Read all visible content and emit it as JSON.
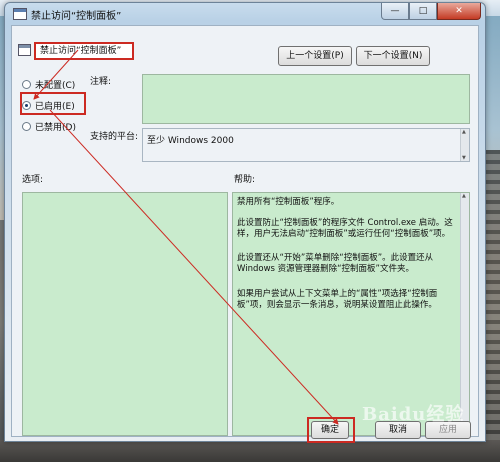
{
  "window": {
    "title": "禁止访问“控制面板”",
    "close_icon": "close-icon",
    "colors": {
      "highlight": "#cc2a22",
      "pane_green": "#c9ebcd"
    }
  },
  "policy": {
    "name": "禁止访问“控制面板”"
  },
  "navigation": {
    "prev_label": "上一个设置(P)",
    "next_label": "下一个设置(N)"
  },
  "state": {
    "options": [
      {
        "label": "未配置(C)",
        "selected": false
      },
      {
        "label": "已启用(E)",
        "selected": true
      },
      {
        "label": "已禁用(D)",
        "selected": false
      }
    ]
  },
  "comment": {
    "label": "注释:",
    "value": ""
  },
  "platform": {
    "label": "支持的平台:",
    "value": "至少 Windows 2000"
  },
  "options_pane": {
    "label": "选项:"
  },
  "help": {
    "label": "帮助:",
    "paragraphs": [
      "禁用所有“控制面板”程序。",
      "此设置防止“控制面板”的程序文件 Control.exe 启动。这样，用户无法启动“控制面板”或运行任何“控制面板”项。",
      "此设置还从“开始”菜单删除“控制面板”。此设置还从 Windows 资源管理器删除“控制面板”文件夹。",
      "如果用户尝试从上下文菜单上的“属性”项选择“控制面板”项，则会显示一条消息，说明某设置阻止此操作。"
    ]
  },
  "footer": {
    "ok_label": "确定",
    "cancel_label": "取消",
    "apply_label": "应用"
  },
  "watermark": "Baidu经验"
}
